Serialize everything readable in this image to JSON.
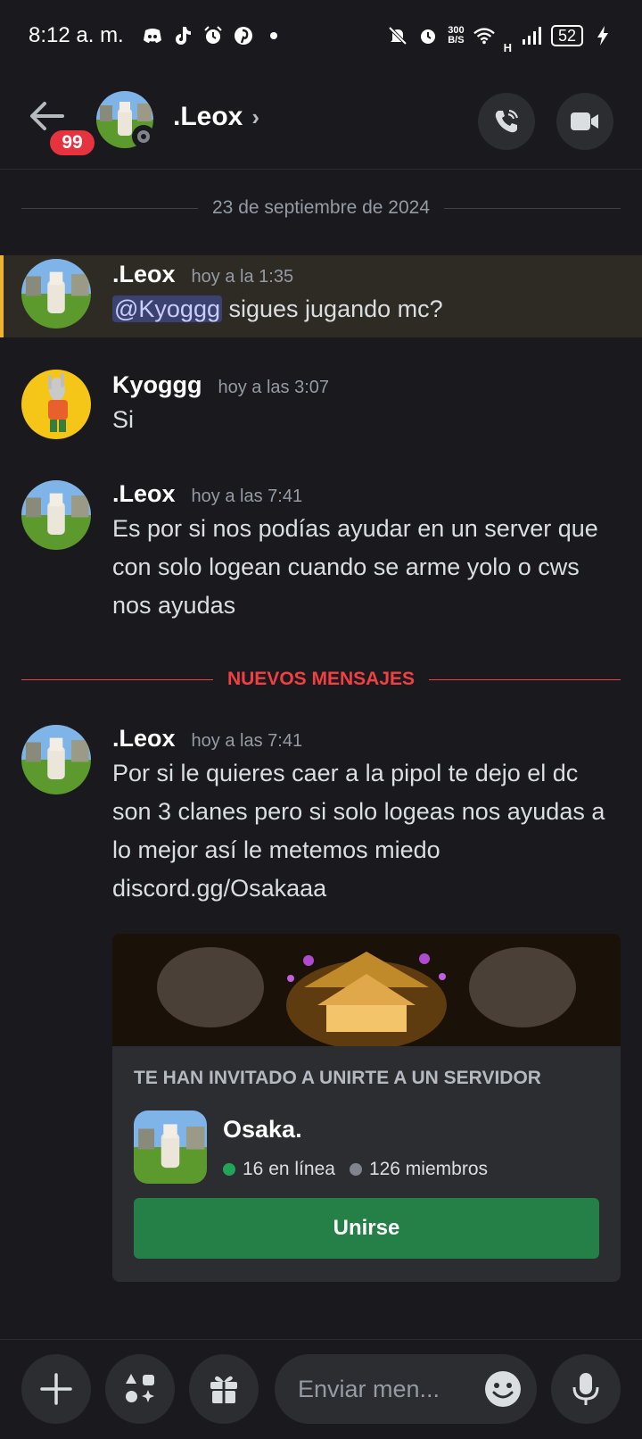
{
  "status_bar": {
    "time": "8:12 a. m.",
    "net_speed_top": "300",
    "net_speed_bottom": "B/S",
    "signal_label": "H",
    "battery": "52"
  },
  "header": {
    "back_badge": "99",
    "channel_name": ".Leox",
    "chevron": "›"
  },
  "date_divider": "23 de septiembre de 2024",
  "new_messages_divider": "NUEVOS MENSAJES",
  "messages": [
    {
      "author": ".Leox",
      "time": "hoy a la 1:35",
      "mention": "@Kyoggg",
      "text": " sigues jugando mc?"
    },
    {
      "author": "Kyoggg",
      "time": "hoy a las 3:07",
      "text": "Si"
    },
    {
      "author": ".Leox",
      "time": "hoy a las 7:41",
      "text": "Es por si nos podías ayudar en un server que con solo logean cuando se arme yolo o cws nos ayudas"
    },
    {
      "author": ".Leox",
      "time": "hoy a las 7:41",
      "text": "Por si le quieres caer a la pipol te dejo el dc son 3 clanes pero si solo logeas nos ayudas a lo mejor así le metemos miedo discord.gg/Osakaaa"
    }
  ],
  "invite": {
    "heading": "TE HAN INVITADO A UNIRTE A UN SERVIDOR",
    "server_name": "Osaka.",
    "online": "16 en línea",
    "members": "126 miembros",
    "join_label": "Unirse"
  },
  "composer": {
    "placeholder": "Enviar men..."
  },
  "icons": {
    "back": "arrow-left-icon",
    "call": "phone-icon",
    "video": "video-camera-icon",
    "add": "plus-icon",
    "apps": "apps-icon",
    "gift": "gift-icon",
    "emoji": "emoji-icon",
    "mic": "microphone-icon"
  },
  "colors": {
    "background": "#1a1a1e",
    "mention_highlight": "#f0b232",
    "new_messages": "#f23f43",
    "join_button": "#248046",
    "notification_badge": "#e5343f"
  }
}
